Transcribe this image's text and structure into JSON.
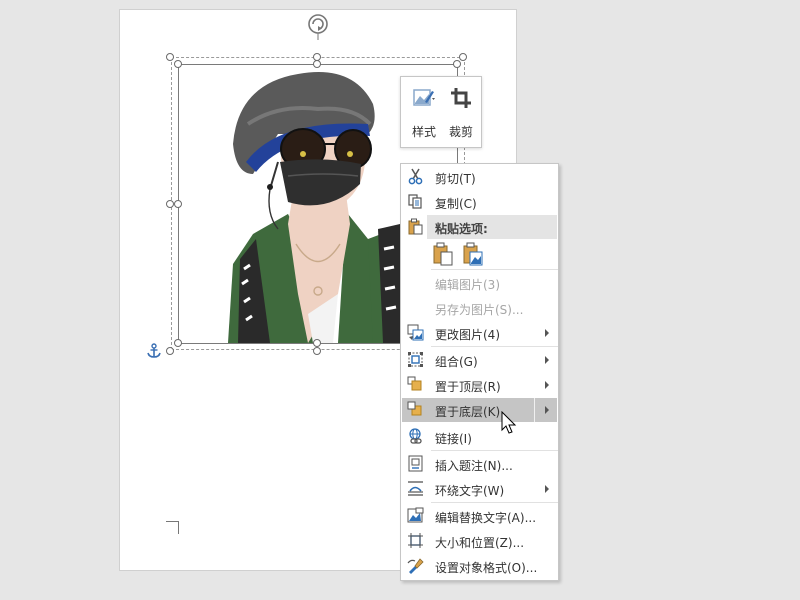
{
  "document": {
    "page": "document-page",
    "picture": "cartoon-boy-with-sunglasses-and-mask"
  },
  "mini_toolbar": {
    "style_label": "样式",
    "crop_label": "裁剪"
  },
  "context_menu": {
    "items": [
      {
        "label": "剪切(T)",
        "icon": "scissors-icon",
        "disabled": false,
        "submenu": false
      },
      {
        "label": "复制(C)",
        "icon": "copy-icon",
        "disabled": false,
        "submenu": false
      },
      {
        "label": "粘贴选项:",
        "icon": "paste-icon",
        "header": true
      },
      {
        "label": "编辑图片(3)",
        "icon": "",
        "disabled": true,
        "submenu": false
      },
      {
        "label": "另存为图片(S)...",
        "icon": "",
        "disabled": true,
        "submenu": false
      },
      {
        "label": "更改图片(4)",
        "icon": "change-picture-icon",
        "disabled": false,
        "submenu": true
      },
      {
        "label": "组合(G)",
        "icon": "group-icon",
        "disabled": false,
        "submenu": true
      },
      {
        "label": "置于顶层(R)",
        "icon": "bring-to-front-icon",
        "disabled": false,
        "submenu": true
      },
      {
        "label": "置于底层(K)",
        "icon": "send-to-back-icon",
        "disabled": false,
        "submenu": true,
        "highlighted": true
      },
      {
        "label": "链接(I)",
        "icon": "link-icon",
        "disabled": false,
        "submenu": false
      },
      {
        "label": "插入题注(N)...",
        "icon": "insert-caption-icon",
        "disabled": false,
        "submenu": false
      },
      {
        "label": "环绕文字(W)",
        "icon": "wrap-text-icon",
        "disabled": false,
        "submenu": true
      },
      {
        "label": "编辑替换文字(A)...",
        "icon": "alt-text-icon",
        "disabled": false,
        "submenu": false
      },
      {
        "label": "大小和位置(Z)...",
        "icon": "size-position-icon",
        "disabled": false,
        "submenu": false
      },
      {
        "label": "设置对象格式(O)...",
        "icon": "format-object-icon",
        "disabled": false,
        "submenu": false
      }
    ],
    "paste_options": [
      "keep-source-formatting-icon",
      "picture-paste-icon"
    ]
  },
  "colors": {
    "highlight": "#c5c5c5",
    "icon_blue": "#2e6fb6",
    "jacket_green": "#3f6a3d",
    "anchor_blue": "#3a6fb3"
  }
}
